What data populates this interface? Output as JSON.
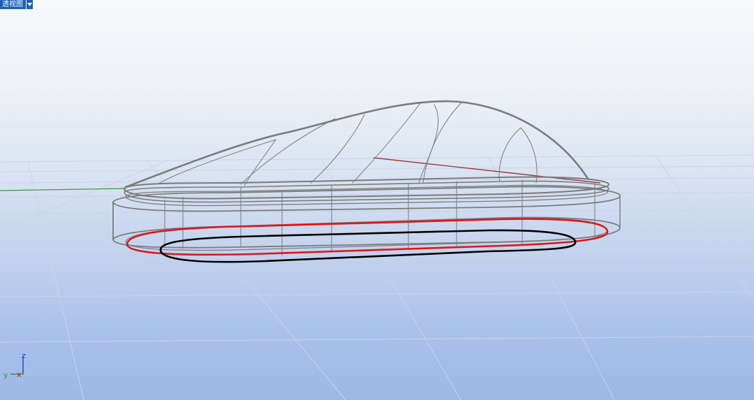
{
  "viewport": {
    "title": "透视图",
    "menu_icon": "chevron-down-icon"
  },
  "axes": {
    "z_label": "z",
    "y_label": "y",
    "x_label": "x",
    "colors": {
      "x": "#c0191c",
      "y": "#2e9c2e",
      "z": "#2b39c8"
    }
  },
  "colors": {
    "viewport_tab": "#1b5fb8",
    "wire": "#7b7b7b",
    "highlight_curve": "#e01616",
    "selected_curve": "#000000",
    "grid": "#c8d3e4"
  }
}
